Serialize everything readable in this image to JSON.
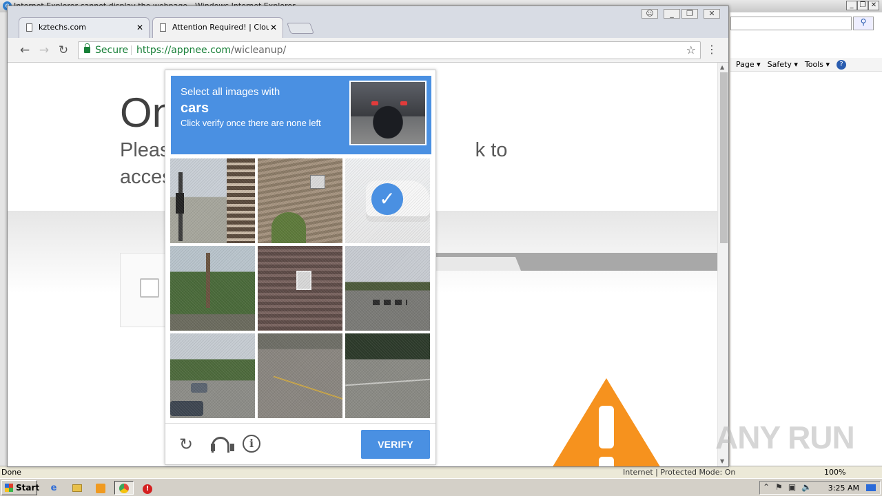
{
  "ie": {
    "title": "Internet Explorer cannot display the webpage - Windows Internet Explorer",
    "toolbar": {
      "page": "Page ▾",
      "safety": "Safety ▾",
      "tools": "Tools ▾",
      "help": "?"
    },
    "status": {
      "left": "Done",
      "zone": "Internet | Protected Mode: On",
      "zoom": "100%"
    }
  },
  "chrome": {
    "tabs": [
      {
        "label": "kztechs.com"
      },
      {
        "label": "Attention Required! | Cloudflare"
      }
    ],
    "omnibox": {
      "secure_label": "Secure",
      "scheme": "https://",
      "host": "appnee.com",
      "path": "/wicleanup/"
    }
  },
  "page": {
    "heading": "On",
    "subtext": "Pleas                                                       k to access appn"
  },
  "recaptcha": {
    "instruction_line1": "Select all images with",
    "target": "cars",
    "instruction_line3": "Click verify once there are none left",
    "verify_label": "VERIFY",
    "tiles_selected": [
      false,
      false,
      true,
      false,
      false,
      false,
      false,
      false,
      false
    ],
    "accent_color": "#4a90e2"
  },
  "taskbar": {
    "start_label": "Start",
    "clock": "3:25 AM"
  },
  "watermark": "ANY RUN"
}
